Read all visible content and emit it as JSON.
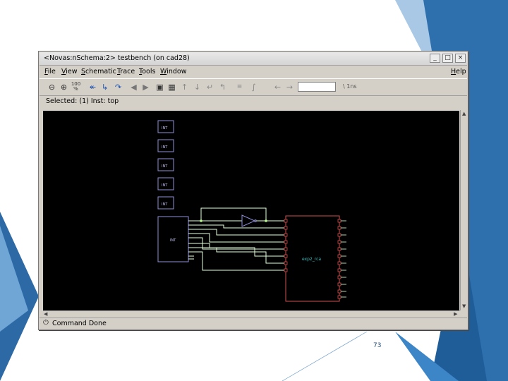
{
  "window": {
    "title": "<Novas:nSchema:2> testbench (on cad28)",
    "controls": [
      "_",
      "□",
      "×"
    ]
  },
  "menubar": {
    "items": [
      "File",
      "View",
      "Schematic",
      "Trace",
      "Tools",
      "Window"
    ],
    "help": "Help"
  },
  "toolbar": {
    "zoom_fit_label": "100\n%",
    "search_suffix": "\\ 1ns"
  },
  "selection": {
    "text": "Selected: (1) Inst: top"
  },
  "schematic": {
    "input_block_label": "INT",
    "main_block_label": "INT",
    "dut_label": "exp2_rca",
    "colors": {
      "background": "#000000",
      "instance": "#8f8fd8",
      "dut": "#d05050",
      "wire": "#e8ffe0",
      "dut_label": "#40c0c0"
    }
  },
  "status": {
    "text": "Command Done"
  },
  "page": {
    "number": "73"
  },
  "theme": {
    "accent": "#1f5fa0",
    "accent_light": "#5ea0d8",
    "chrome": "#d4d0c8"
  }
}
